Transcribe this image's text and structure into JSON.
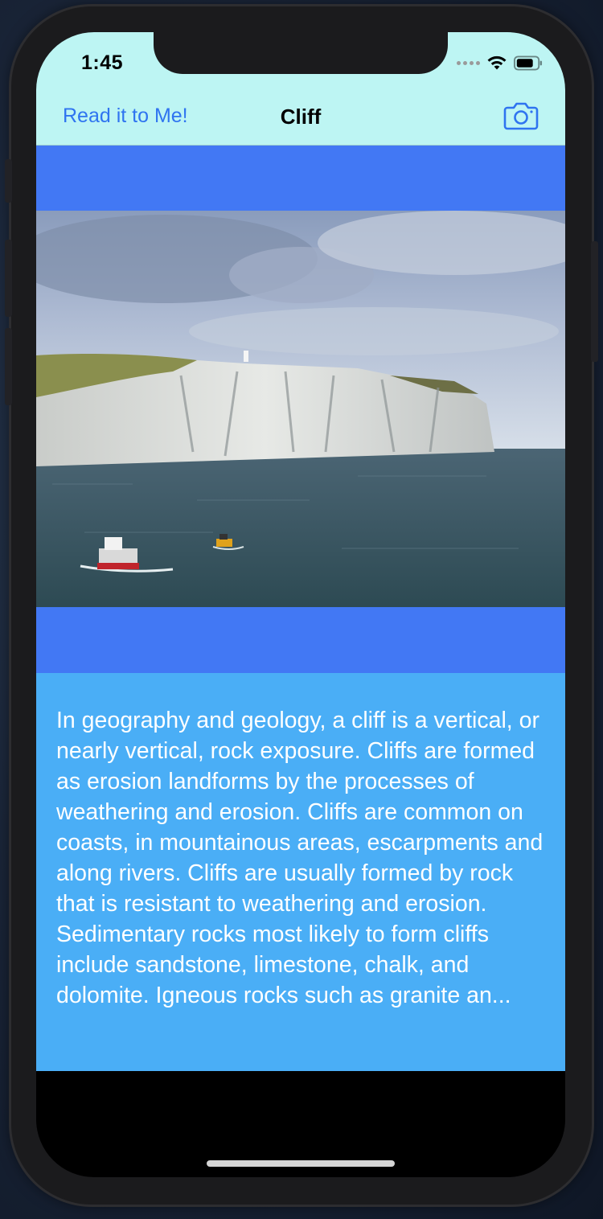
{
  "status_bar": {
    "time": "1:45"
  },
  "nav_bar": {
    "read_button_label": "Read it to Me!",
    "title": "Cliff",
    "camera_icon": "camera-icon"
  },
  "content": {
    "image_subject": "white chalk cliffs with boats on sea",
    "description": "In geography and geology, a cliff is a vertical, or nearly vertical, rock exposure. Cliffs are formed as erosion landforms by the processes of weathering and erosion. Cliffs are common on coasts, in mountainous areas, escarpments and along rivers. Cliffs are usually formed by rock that is resistant to weathering and erosion. Sedimentary rocks most likely to form cliffs include sandstone, limestone, chalk, and dolomite. Igneous rocks such as granite an..."
  },
  "colors": {
    "nav_background": "#bdf5f3",
    "tint": "#2f74f0",
    "image_band": "#4278f4",
    "text_panel": "#4aaef6",
    "text": "#ffffff"
  }
}
